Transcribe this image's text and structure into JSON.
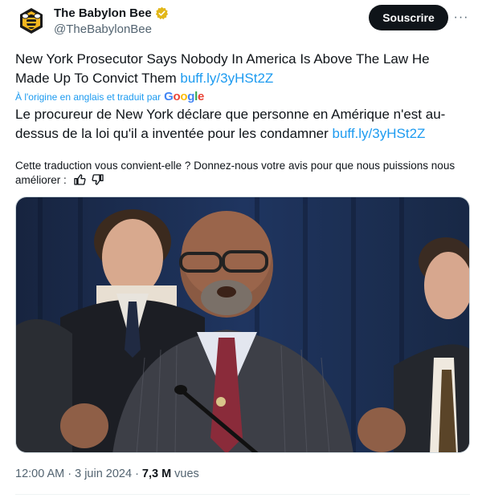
{
  "account": {
    "display_name": "The Babylon Bee",
    "handle": "@TheBabylonBee",
    "verified_color": "#e2b719"
  },
  "actions": {
    "subscribe_label": "Souscrire",
    "more_label": "···"
  },
  "tweet": {
    "original_text": "New York Prosecutor Says Nobody In America Is Above The Law He Made Up To Convict Them",
    "original_link": "buff.ly/3yHSt2Z",
    "translation_source": "À l'origine en anglais et traduit par",
    "translation_provider": "Google",
    "translated_text": "Le procureur de New York déclare que personne en Amérique n'est au-dessus de la loi qu'il a inventée pour les condamner",
    "translated_link": "buff.ly/3yHSt2Z",
    "feedback_prompt": "Cette traduction vous convient-elle ? Donnez-nous votre avis pour que nous puissions nous améliorer :"
  },
  "meta": {
    "time": "12:00 AM",
    "date": "3 juin 2024",
    "separator": "·",
    "views_count": "7,3 M",
    "views_label": "vues"
  },
  "colors": {
    "accent": "#1d9bf0",
    "text": "#0f1419",
    "secondary": "#536471"
  },
  "icons": [
    "bee-logo-icon",
    "verified-badge-icon",
    "more-icon",
    "thumbs-up-icon",
    "thumbs-down-icon"
  ]
}
